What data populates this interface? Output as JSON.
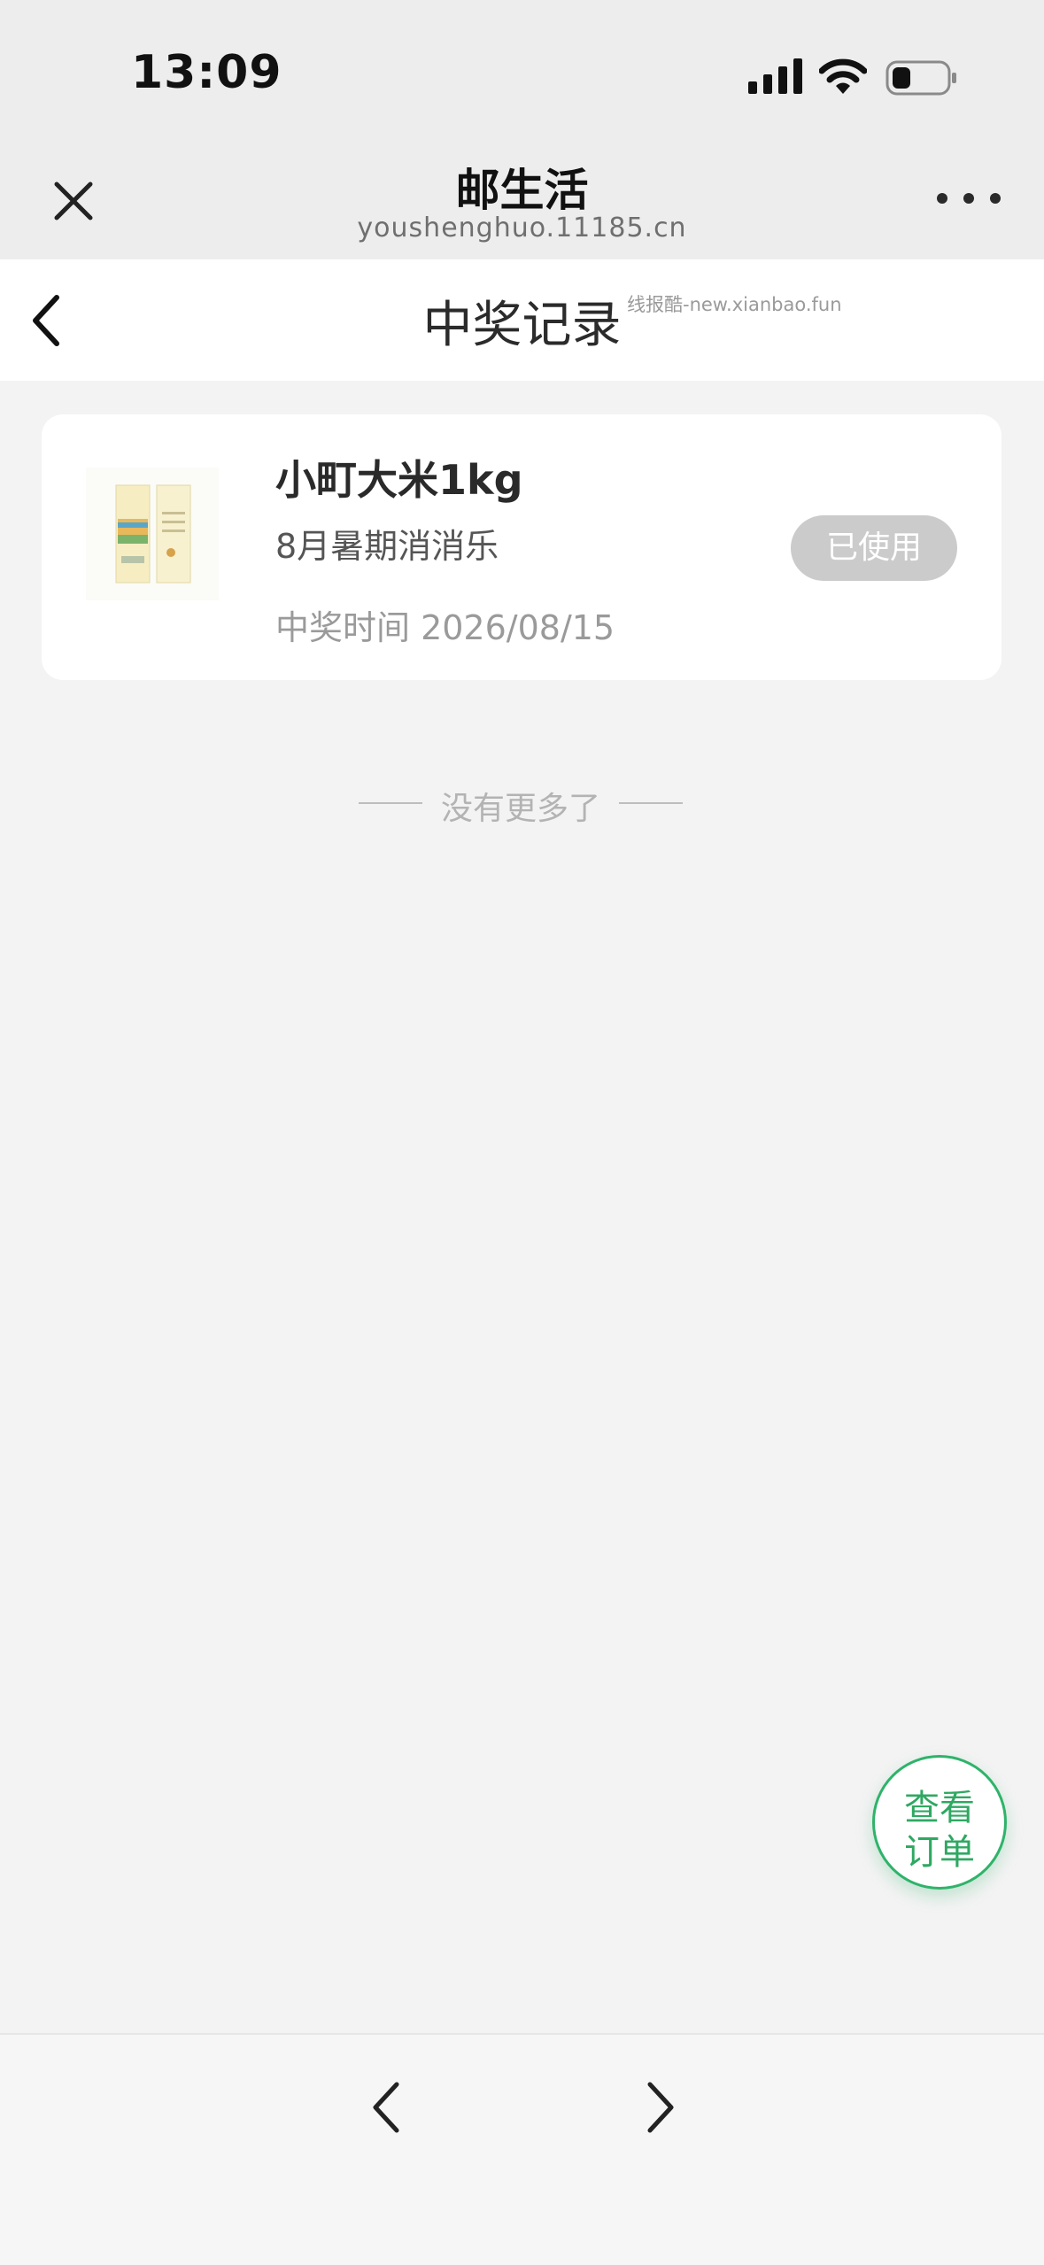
{
  "status_bar": {
    "time": "13:09"
  },
  "browser": {
    "title": "邮生活",
    "url": "youshenghuo.11185.cn"
  },
  "page": {
    "title": "中奖记录",
    "watermark": "线报酷-new.xianbao.fun"
  },
  "records": [
    {
      "prize_name": "小町大米1kg",
      "activity": "8月暑期消消乐",
      "win_time": "中奖时间 2026/08/15",
      "status": "已使用"
    }
  ],
  "list_end_text": "没有更多了",
  "fab": {
    "line1": "查看",
    "line2": "订单"
  },
  "colors": {
    "accent": "#2fb36a",
    "badge_bg": "#cbcbcb",
    "page_bg": "#f3f3f3"
  }
}
